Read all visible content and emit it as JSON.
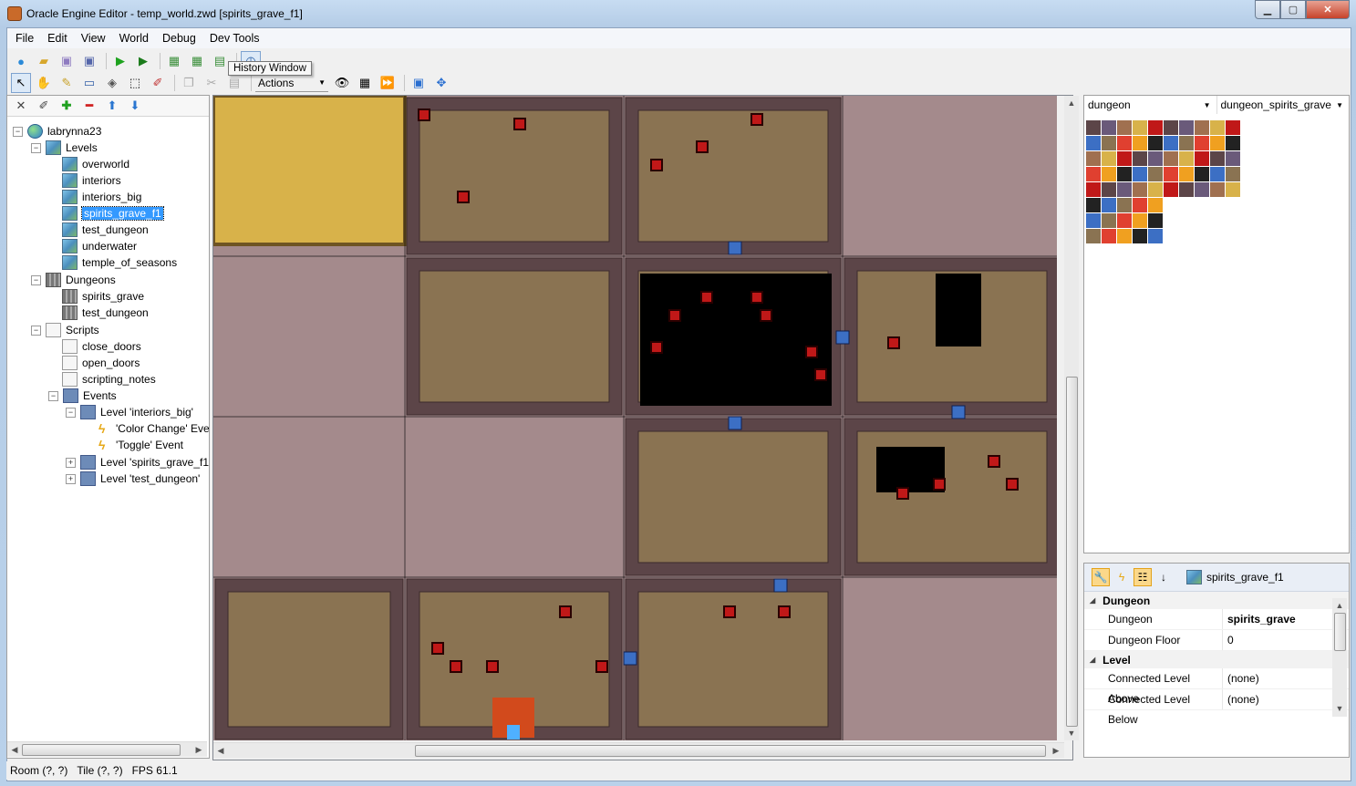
{
  "window": {
    "title": "Oracle Engine Editor - temp_world.zwd [spirits_grave_f1]"
  },
  "menu": [
    "File",
    "Edit",
    "View",
    "World",
    "Debug",
    "Dev Tools"
  ],
  "toolbar1": {
    "icons": [
      "world-icon",
      "open-icon",
      "save-icon",
      "save-as-icon",
      "play-icon",
      "play-debug-icon",
      "add-level-icon",
      "add-dungeon-icon",
      "add-script-icon",
      "history-icon"
    ]
  },
  "toolbar2": {
    "actions_label": "Actions",
    "tooltip": "History Window"
  },
  "tree": {
    "root": "labrynna23",
    "levels_label": "Levels",
    "levels": [
      "overworld",
      "interiors",
      "interiors_big",
      "spirits_grave_f1",
      "test_dungeon",
      "underwater",
      "temple_of_seasons"
    ],
    "selected": "spirits_grave_f1",
    "dungeons_label": "Dungeons",
    "dungeons": [
      "spirits_grave",
      "test_dungeon"
    ],
    "scripts_label": "Scripts",
    "scripts": [
      "close_doors",
      "open_doors",
      "scripting_notes"
    ],
    "events_label": "Events",
    "event_level_1": "Level 'interiors_big'",
    "event_1": "'Color Change' Eve",
    "event_2": "'Toggle' Event",
    "event_level_2": "Level 'spirits_grave_f1'",
    "event_level_3": "Level 'test_dungeon'"
  },
  "tileset": {
    "group": "dungeon",
    "name": "dungeon_spirits_grave"
  },
  "properties": {
    "object_name": "spirits_grave_f1",
    "cat_dungeon": "Dungeon",
    "dungeon_label": "Dungeon",
    "dungeon_value": "spirits_grave",
    "floor_label": "Dungeon Floor",
    "floor_value": "0",
    "cat_level": "Level",
    "above_label": "Connected Level Above",
    "above_value": "(none)",
    "below_label": "Connected Level Below",
    "below_value": "(none)"
  },
  "status": {
    "room": "Room (?, ?)",
    "tile": "Tile (?, ?)",
    "fps": "FPS 61.1"
  },
  "colors": {
    "void": "#a48a8c",
    "floor": "#8a7352",
    "wall": "#5c4548",
    "sand": "#d8b24a",
    "selection": "#3399ff"
  }
}
